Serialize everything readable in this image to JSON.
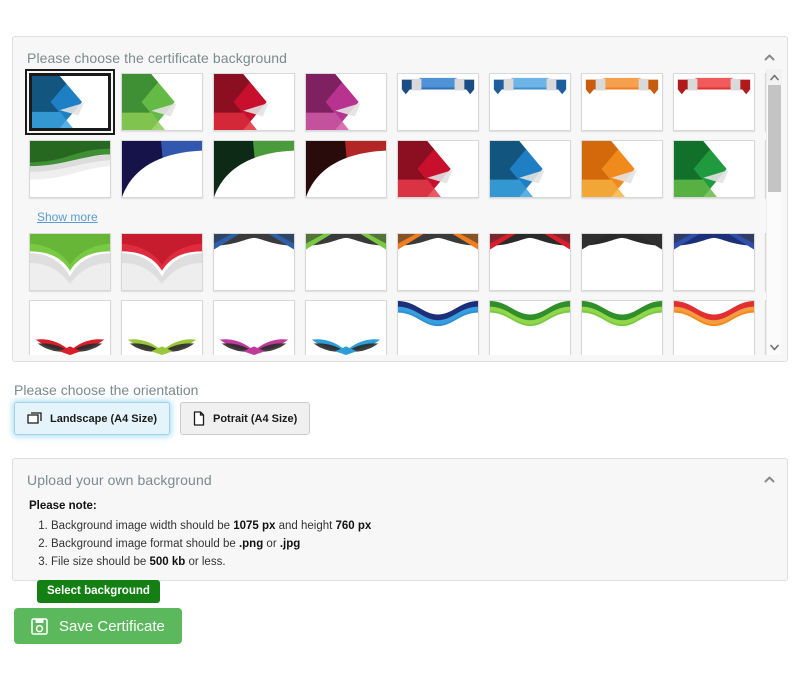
{
  "background_panel": {
    "title": "Please choose the certificate background",
    "collapse_icon": "chevron-up-icon",
    "show_more_label": "Show more",
    "scrollbar": {
      "up_icon": "chevron-up-icon",
      "down_icon": "chevron-down-icon"
    },
    "thumbnails": [
      [
        {
          "style": "wedge",
          "c1": "#1f7fc4",
          "c2": "#12557f",
          "c3": "#3aa3e0",
          "selected": true
        },
        {
          "style": "wedge",
          "c1": "#63bb46",
          "c2": "#3f8f35",
          "c3": "#8ccc54",
          "selected": false
        },
        {
          "style": "wedge",
          "c1": "#c8102e",
          "c2": "#8c0f21",
          "c3": "#e02b3c",
          "selected": false
        },
        {
          "style": "wedge",
          "c1": "#b8328f",
          "c2": "#7f2060",
          "c3": "#cf5aa8",
          "selected": false
        },
        {
          "style": "ribbon",
          "c1": "#2e6fb5",
          "c2": "#1c4c84",
          "c3": "#4f93d6",
          "selected": false
        },
        {
          "style": "ribbon",
          "c1": "#3d8fd1",
          "c2": "#1f5e9e",
          "c3": "#6fb4e6",
          "selected": false
        },
        {
          "style": "ribbon",
          "c1": "#ef7d22",
          "c2": "#c85c0c",
          "c3": "#f6a04e",
          "selected": false
        },
        {
          "style": "ribbon",
          "c1": "#e03030",
          "c2": "#b01a1a",
          "c3": "#f05a5a",
          "selected": false
        },
        {
          "style": "swoosh",
          "c1": "#d81e2a",
          "c2": "#8c0f18",
          "c3": "#f05a5a",
          "selected": false
        },
        {
          "style": "swoosh",
          "c1": "#1e2f7a",
          "c2": "#0e1b4d",
          "c3": "#3f55ab",
          "selected": false
        }
      ],
      [
        {
          "style": "swoosh",
          "c1": "#3f8f35",
          "c2": "#23611c",
          "c3": "#72bf55",
          "selected": false
        },
        {
          "style": "arc",
          "c1": "#16124a",
          "c2": "#0a0822",
          "c3": "#3b6fd1",
          "selected": false
        },
        {
          "style": "arc",
          "c1": "#0d2a16",
          "c2": "#050f09",
          "c3": "#5fc24a",
          "selected": false
        },
        {
          "style": "arc",
          "c1": "#2a0b0b",
          "c2": "#0d0404",
          "c3": "#e03030",
          "selected": false
        },
        {
          "style": "wedge",
          "c1": "#c8102e",
          "c2": "#8c0f21",
          "c3": "#e8394a",
          "selected": false
        },
        {
          "style": "wedge",
          "c1": "#1f7fc4",
          "c2": "#12557f",
          "c3": "#3aa3e0",
          "selected": false
        },
        {
          "style": "wedge",
          "c1": "#f08a1c",
          "c2": "#d3690a",
          "c3": "#f7b13f",
          "selected": false
        },
        {
          "style": "wedge",
          "c1": "#1f9a3f",
          "c2": "#11702a",
          "c3": "#63bb46",
          "selected": false
        },
        {
          "style": "dome",
          "c1": "#3aa3e0",
          "c2": "#1f7fc4",
          "c3": "#d8d8d8",
          "selected": false
        }
      ],
      [
        {
          "style": "dome",
          "c1": "#7ac943",
          "c2": "#5aa62f",
          "c3": "#d8d8d8",
          "selected": false
        },
        {
          "style": "dome",
          "c1": "#e02b3c",
          "c2": "#b01020",
          "c3": "#d8d8d8",
          "selected": false
        },
        {
          "style": "peak",
          "c1": "#3a3a3a",
          "c2": "#2f5fa8",
          "c3": "#2f5fa8",
          "selected": false
        },
        {
          "style": "peak",
          "c1": "#3a3a3a",
          "c2": "#7ac943",
          "c3": "#7ac943",
          "selected": false
        },
        {
          "style": "peak",
          "c1": "#3a3a3a",
          "c2": "#ef7d22",
          "c3": "#ef7d22",
          "selected": false
        },
        {
          "style": "peak",
          "c1": "#2a2a2a",
          "c2": "#d81e2a",
          "c3": "#d81e2a",
          "selected": false
        },
        {
          "style": "peak",
          "c1": "#2a2a2a",
          "c2": "#2f2f2f",
          "c3": "#2f2f2f",
          "selected": false
        },
        {
          "style": "peak",
          "c1": "#1e2f7a",
          "c2": "#2f4fa8",
          "c3": "#2f4fa8",
          "selected": false
        },
        {
          "style": "peak",
          "c1": "#3a3a3a",
          "c2": "#ef7d22",
          "c3": "#ef7d22",
          "selected": false
        }
      ],
      [
        {
          "style": "laurel",
          "c1": "#d81e2a",
          "c2": "#2a2a2a",
          "c3": "#d81e2a",
          "selected": false
        },
        {
          "style": "laurel",
          "c1": "#9ac63b",
          "c2": "#2a2a2a",
          "c3": "#9ac63b",
          "selected": false
        },
        {
          "style": "laurel",
          "c1": "#c03a9a",
          "c2": "#2a2a2a",
          "c3": "#c03a9a",
          "selected": false
        },
        {
          "style": "laurel",
          "c1": "#2f9ed6",
          "c2": "#2a2a2a",
          "c3": "#2f9ed6",
          "selected": false
        },
        {
          "style": "wave",
          "c1": "#1e2f7a",
          "c2": "#2f8fd6",
          "c3": "#3aa3e0",
          "selected": false
        },
        {
          "style": "wave",
          "c1": "#2f8f2a",
          "c2": "#7ac943",
          "c3": "#9ad94f",
          "selected": false
        },
        {
          "style": "wave",
          "c1": "#2f8f2a",
          "c2": "#7ac943",
          "c3": "#9ad94f",
          "selected": false
        },
        {
          "style": "wave",
          "c1": "#e03030",
          "c2": "#f08a1c",
          "c3": "#f6a04e",
          "selected": false
        },
        {
          "style": "flag",
          "c1": "#d81e2a",
          "c2": "#8c0f18",
          "c3": "#e8e8e8",
          "selected": false
        },
        {
          "style": "flag",
          "c1": "#2f9ed6",
          "c2": "#1f6fa8",
          "c3": "#e8e8e8",
          "selected": false
        }
      ],
      [
        {
          "style": "clip",
          "c1": "#b8328f",
          "c2": "#7f2060",
          "c3": "#e8e8e8",
          "selected": false
        },
        {
          "style": "clip",
          "c1": "#3f9e4a",
          "c2": "#26702f",
          "c3": "#e8e8e8",
          "selected": false
        },
        {
          "style": "clip",
          "c1": "#2f8fd6",
          "c2": "#1f6fa8",
          "c3": "#ffffff",
          "selected": false
        },
        {
          "style": "clip",
          "c1": "#e02b3c",
          "c2": "#b01020",
          "c3": "#ffffff",
          "selected": false
        },
        {
          "style": "clip",
          "c1": "#e8709a",
          "c2": "#c24a78",
          "c3": "#ffffff",
          "selected": false
        },
        {
          "style": "clip",
          "c1": "#f0a060",
          "c2": "#d3690a",
          "c3": "#ffffff",
          "selected": false
        },
        {
          "style": "clip",
          "c1": "#c8a0b8",
          "c2": "#a07890",
          "c3": "#ffffff",
          "selected": false
        },
        {
          "style": "clip",
          "c1": "#e02b3c",
          "c2": "#b01020",
          "c3": "#ffffff",
          "selected": false
        },
        {
          "style": "clip",
          "c1": "#2f8fd6",
          "c2": "#1f6fa8",
          "c3": "#ffffff",
          "selected": false
        }
      ]
    ]
  },
  "orientation": {
    "label": "Please choose the orientation",
    "options": [
      {
        "label": "Landscape (A4 Size)",
        "icon": "landscape-page-icon",
        "active": true
      },
      {
        "label": "Potrait (A4 Size)",
        "icon": "portrait-page-icon",
        "active": false
      }
    ]
  },
  "upload_panel": {
    "title": "Upload your own background",
    "collapse_icon": "chevron-up-icon",
    "note_heading": "Please note:",
    "notes": [
      {
        "prefix": "Background image width should be ",
        "bold1": "1075 px",
        "middle": " and height ",
        "bold2": "760 px",
        "suffix": ""
      },
      {
        "prefix": "Background image format should be ",
        "bold1": ".png",
        "middle": " or ",
        "bold2": ".jpg",
        "suffix": ""
      },
      {
        "prefix": "File size should be ",
        "bold1": "500 kb",
        "middle": " or less.",
        "bold2": "",
        "suffix": ""
      }
    ],
    "select_button_label": "Select background"
  },
  "save": {
    "label": "Save Certificate",
    "icon": "save-floppy-icon"
  },
  "colors": {
    "panel_bg": "#f7f7f7",
    "heading_text": "#7b8a8b",
    "link": "#5b9bd5",
    "save_green": "#5cb85c",
    "select_green": "#148014",
    "active_blue": "#e5f4fb"
  }
}
